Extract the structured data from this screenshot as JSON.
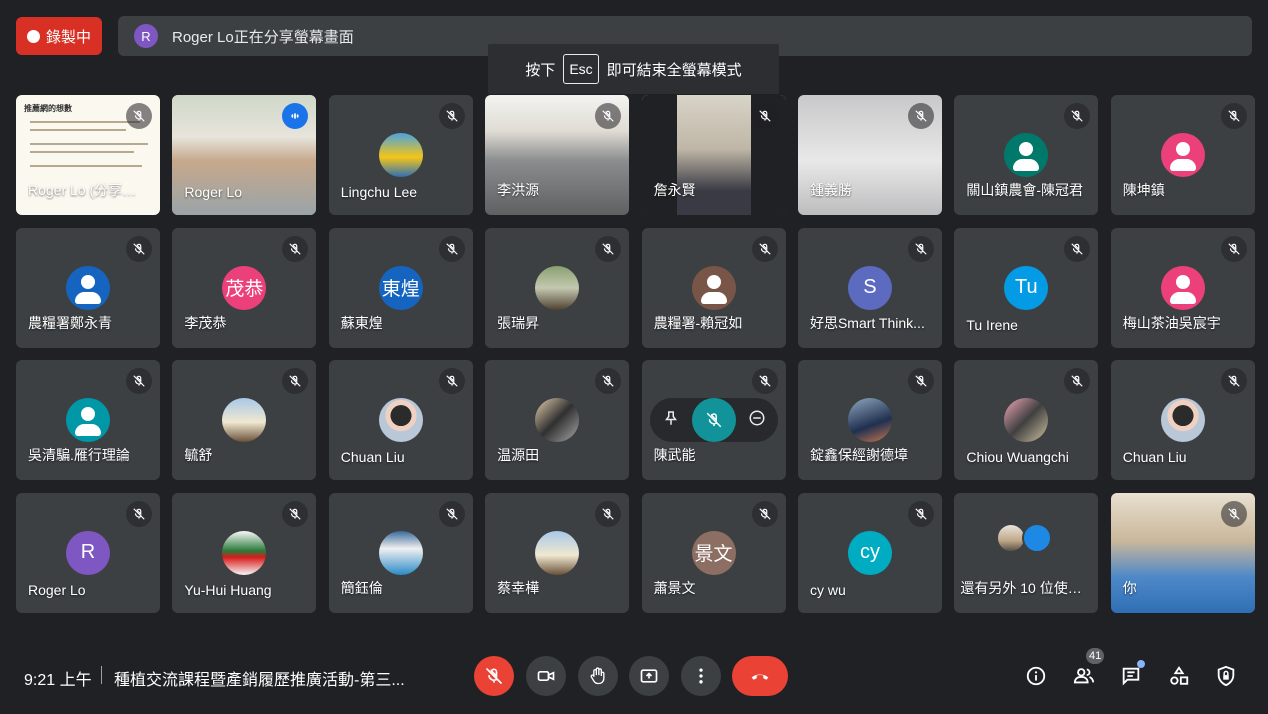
{
  "recording": {
    "label": "錄製中"
  },
  "presentation_banner": {
    "avatar_letter": "R",
    "text": "Roger Lo正在分享螢幕畫面"
  },
  "esc_toast": {
    "prefix": "按下",
    "key": "Esc",
    "suffix": "即可結束全螢幕模式"
  },
  "tiles": [
    {
      "id": "presentation",
      "name": "Roger Lo (分享螢幕...",
      "type": "presentation",
      "slide_title": "推薦網的想數"
    },
    {
      "id": "roger-video",
      "name": "Roger Lo",
      "type": "video",
      "speaking": true
    },
    {
      "id": "lingchu",
      "name": "Lingchu Lee",
      "type": "photo"
    },
    {
      "id": "li-hongyuan",
      "name": "李洪源",
      "type": "video"
    },
    {
      "id": "zhan-yongxian",
      "name": "詹永賢",
      "type": "video"
    },
    {
      "id": "zhong-yisheng",
      "name": "鍾義勝",
      "type": "video"
    },
    {
      "id": "guanshan",
      "name": "關山鎮農會-陳冠君",
      "type": "avatar",
      "color": "#00796b"
    },
    {
      "id": "chen-kunzhen",
      "name": "陳坤鎮",
      "type": "avatar",
      "color": "#ec407a"
    },
    {
      "id": "zheng-yongqing",
      "name": "農糧署鄭永青",
      "type": "avatar",
      "color": "#1565c0"
    },
    {
      "id": "li-maogong",
      "name": "李茂恭",
      "type": "initials",
      "initials": "茂恭",
      "color": "#ec407a"
    },
    {
      "id": "su-donghuang",
      "name": "蘇東煌",
      "type": "initials",
      "initials": "東煌",
      "color": "#1565c0"
    },
    {
      "id": "zhang-ruisheng",
      "name": "張瑞昇",
      "type": "photo"
    },
    {
      "id": "lai-guanru",
      "name": "農糧署-賴冠如",
      "type": "avatar",
      "color": "#795548"
    },
    {
      "id": "haosi",
      "name": "好思Smart Think...",
      "type": "initials",
      "initials": "S",
      "color": "#5c6bc0"
    },
    {
      "id": "tu-irene",
      "name": "Tu Irene",
      "type": "initials",
      "initials": "Tu",
      "color": "#039be5"
    },
    {
      "id": "meishan",
      "name": "梅山茶油吳宸宇",
      "type": "avatar",
      "color": "#ec407a"
    },
    {
      "id": "wu-qingbian",
      "name": "吳清騙.雁行理論",
      "type": "avatar",
      "color": "#0097a7"
    },
    {
      "id": "yushu",
      "name": "毓舒",
      "type": "photo"
    },
    {
      "id": "chuan-liu-1",
      "name": "Chuan Liu",
      "type": "photo"
    },
    {
      "id": "wen-yuantian",
      "name": "温源田",
      "type": "photo"
    },
    {
      "id": "chen-wuneng",
      "name": "陳武能",
      "type": "hover"
    },
    {
      "id": "dingxin",
      "name": "錠鑫保經謝德墇",
      "type": "photo"
    },
    {
      "id": "chiou",
      "name": "Chiou Wuangchi",
      "type": "photo"
    },
    {
      "id": "chuan-liu-2",
      "name": "Chuan Liu",
      "type": "photo"
    },
    {
      "id": "roger-lo-2",
      "name": "Roger Lo",
      "type": "initials",
      "initials": "R",
      "color": "#7e57c2"
    },
    {
      "id": "yu-hui",
      "name": "Yu-Hui Huang",
      "type": "photo"
    },
    {
      "id": "jian-tinglun",
      "name": "簡鈺倫",
      "type": "photo"
    },
    {
      "id": "cai-xinhua",
      "name": "蔡幸樺",
      "type": "photo"
    },
    {
      "id": "xiao-jingwen",
      "name": "蕭景文",
      "type": "initials",
      "initials": "景文",
      "color": "#8d6e63"
    },
    {
      "id": "cy-wu",
      "name": "cy wu",
      "type": "initials",
      "initials": "cy",
      "color": "#00acc1"
    },
    {
      "id": "others",
      "name": "還有另外 10 位使用者",
      "type": "others"
    },
    {
      "id": "you",
      "name": "你",
      "type": "video"
    }
  ],
  "bottom": {
    "time": "9:21 上午",
    "meeting_title": "種植交流課程暨產銷履歷推廣活動-第三...",
    "participant_count": "41"
  },
  "icons": {
    "mic_off": "mic-off-icon",
    "camera": "camera-icon",
    "raise_hand": "raise-hand-icon",
    "present": "present-icon",
    "more": "more-vert-icon",
    "end_call": "end-call-icon",
    "info": "info-icon",
    "people": "people-icon",
    "chat": "chat-icon",
    "activities": "activities-icon",
    "host_controls": "shield-lock-icon"
  }
}
